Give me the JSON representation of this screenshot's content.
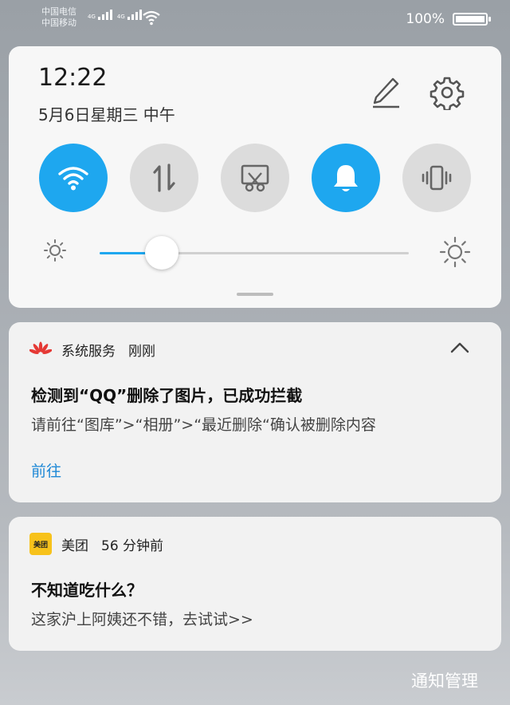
{
  "status_bar": {
    "carrier1": "中国电信",
    "carrier2": "中国移动",
    "net1": "4G",
    "net2": "4G",
    "battery_pct": "100%"
  },
  "quick_panel": {
    "time": "12:22",
    "date": "5月6日星期三 中午",
    "toggles": [
      {
        "name": "wifi",
        "icon": "wifi-icon",
        "on": true
      },
      {
        "name": "mobile-data",
        "icon": "data-transfer-icon",
        "on": false
      },
      {
        "name": "screenshot",
        "icon": "screenshot-icon",
        "on": false
      },
      {
        "name": "notification-sound",
        "icon": "bell-icon",
        "on": true
      },
      {
        "name": "vibrate",
        "icon": "vibrate-icon",
        "on": false
      }
    ],
    "brightness": 0.2
  },
  "notifications": [
    {
      "app": "系统服务",
      "time": "刚刚",
      "title": "检测到“QQ”删除了图片，已成功拦截",
      "body": "请前往“图库”>“相册”>“最近删除“确认被删除内容",
      "action": "前往"
    },
    {
      "app": "美团",
      "time": "56 分钟前",
      "title": "不知道吃什么？",
      "body": "这家沪上阿姨还不错，去试试>>",
      "logo_text": "美团"
    }
  ],
  "footer": {
    "manage_label": "通知管理"
  },
  "colors": {
    "accent": "#1ea7ef",
    "link": "#1e88d6",
    "meituan": "#f7c21b",
    "huawei": "#e53935"
  }
}
